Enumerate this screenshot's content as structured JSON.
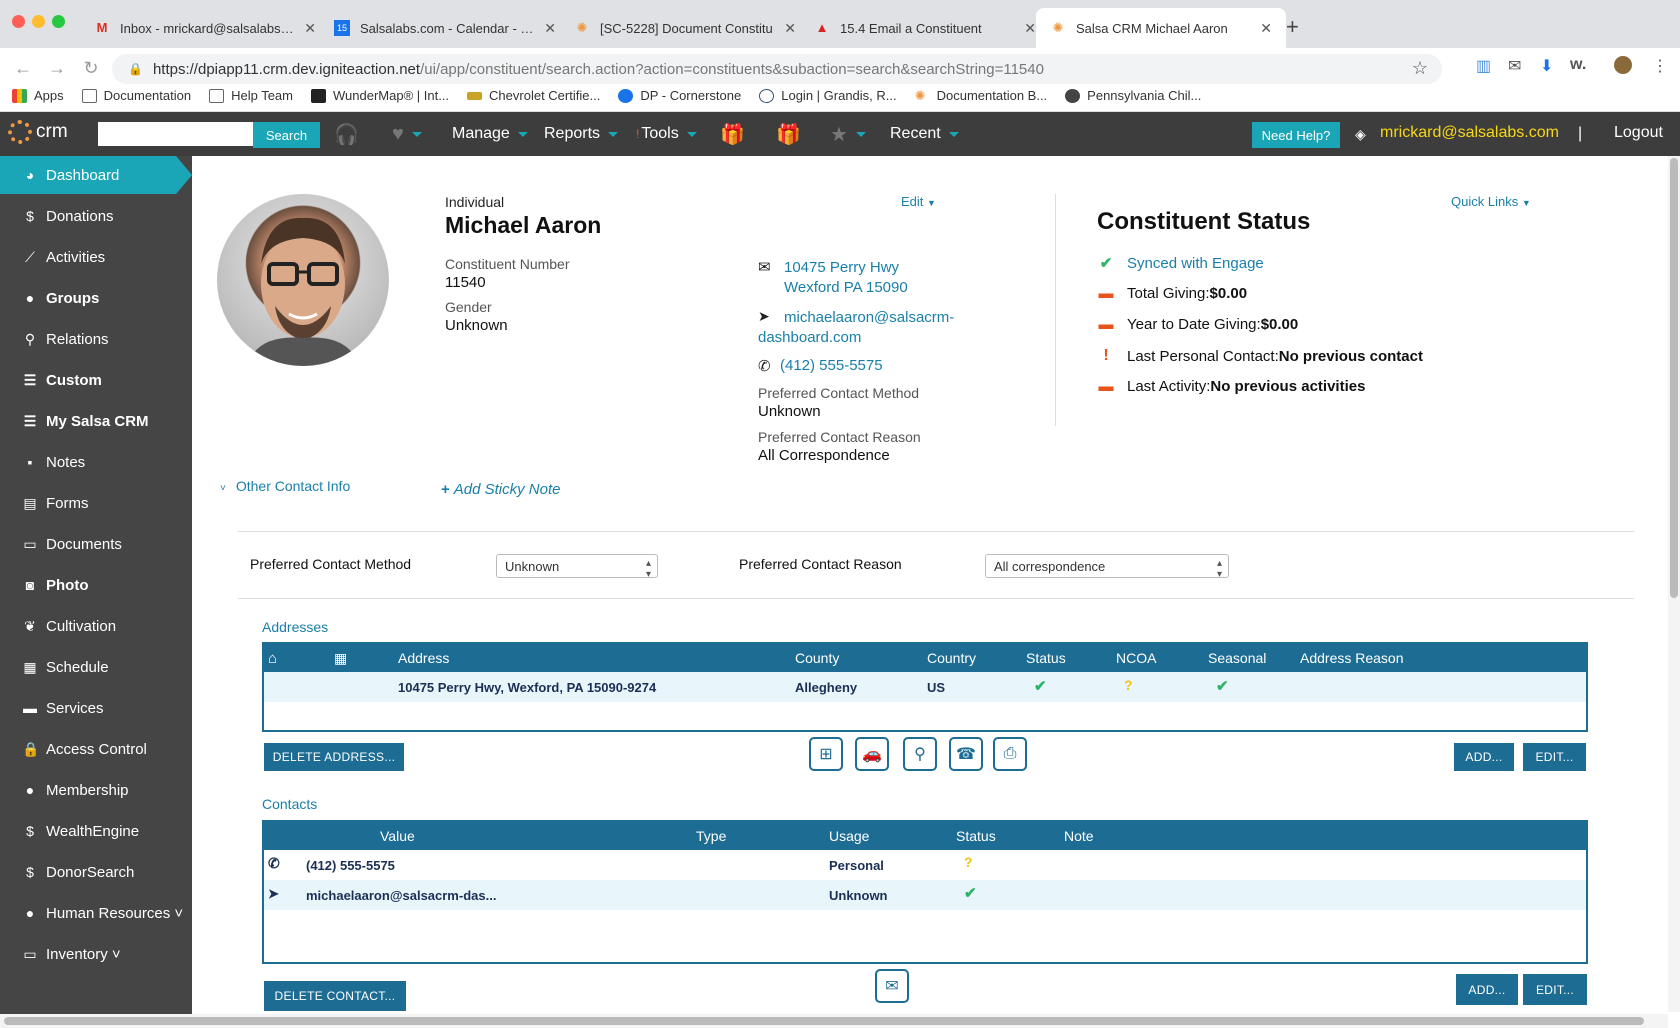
{
  "browser": {
    "tabs": [
      {
        "title": "Inbox - mrickard@salsalabs.co",
        "icon": "gmail-icon",
        "color": "#d93025"
      },
      {
        "title": "Salsalabs.com - Calendar - Mo",
        "icon": "calendar-icon",
        "color": "#1a73e8"
      },
      {
        "title": "[SC-5228] Document Constitu",
        "icon": "salsa-icon",
        "color": "#e94"
      },
      {
        "title": "15.4 Email a Constituent",
        "icon": "alert-icon",
        "color": "#d22"
      },
      {
        "title": "Salsa CRM Michael Aaron",
        "icon": "salsa-icon",
        "color": "#e94"
      }
    ],
    "url_host": "https://dpiapp11.crm.dev.igniteaction.net",
    "url_path": "/ui/app/constituent/search.action?action=constituents&subaction=search&searchString=11540",
    "bookmarks": [
      "Apps",
      "Documentation",
      "Help Team",
      "WunderMap® | Int...",
      "Chevrolet Certifie...",
      "DP - Cornerstone",
      "Login | Grandis, R...",
      "Documentation B...",
      "Pennsylvania Chil..."
    ]
  },
  "topbar": {
    "logo": "crm",
    "search_button": "Search",
    "manage": "Manage",
    "reports": "Reports",
    "tools": "Tools",
    "recent": "Recent",
    "need_help": "Need Help?",
    "user": "mrickard@salsalabs.com",
    "separator": "|",
    "logout": "Logout"
  },
  "sidebar": {
    "items": [
      {
        "label": "Dashboard",
        "icon": "dashboard-icon",
        "glyph": "◕"
      },
      {
        "label": "Donations",
        "icon": "dollar-icon",
        "glyph": "$"
      },
      {
        "label": "Activities",
        "icon": "chart-icon",
        "glyph": "⟋"
      },
      {
        "label": "Groups",
        "icon": "users-icon",
        "glyph": "●"
      },
      {
        "label": "Relations",
        "icon": "link-icon",
        "glyph": "⚲"
      },
      {
        "label": "Custom",
        "icon": "list-icon",
        "glyph": "☰"
      },
      {
        "label": "My Salsa CRM",
        "icon": "list-icon",
        "glyph": "☰"
      },
      {
        "label": "Notes",
        "icon": "note-icon",
        "glyph": "▪"
      },
      {
        "label": "Forms",
        "icon": "form-icon",
        "glyph": "▤"
      },
      {
        "label": "Documents",
        "icon": "folder-icon",
        "glyph": "▭"
      },
      {
        "label": "Photo",
        "icon": "camera-icon",
        "glyph": "◙"
      },
      {
        "label": "Cultivation",
        "icon": "leaf-icon",
        "glyph": "❦"
      },
      {
        "label": "Schedule",
        "icon": "calendar-icon",
        "glyph": "▦"
      },
      {
        "label": "Services",
        "icon": "services-icon",
        "glyph": "▬"
      },
      {
        "label": "Access Control",
        "icon": "lock-icon",
        "glyph": "🔒"
      },
      {
        "label": "Membership",
        "icon": "users-icon",
        "glyph": "●"
      },
      {
        "label": "WealthEngine",
        "icon": "dollar-icon",
        "glyph": "$"
      },
      {
        "label": "DonorSearch",
        "icon": "dollar-icon",
        "glyph": "$"
      },
      {
        "label": "Human Resources ˅",
        "icon": "user-icon",
        "glyph": "●"
      },
      {
        "label": "Inventory ˅",
        "icon": "drive-icon",
        "glyph": "▭"
      }
    ]
  },
  "profile": {
    "type": "Individual",
    "name": "Michael Aaron",
    "edit": "Edit",
    "constituent_number_label": "Constituent Number",
    "constituent_number": "11540",
    "gender_label": "Gender",
    "gender": "Unknown",
    "address_line1": "10475 Perry Hwy",
    "address_line2": "Wexford  PA  15090",
    "email_line1": "michaelaaron@salsacrm-",
    "email_line2": "dashboard.com",
    "phone": "(412) 555-5575",
    "pcm_label": "Preferred Contact Method",
    "pcm": "Unknown",
    "pcr_label": "Preferred Contact Reason",
    "pcr": "All Correspondence",
    "other_contact": "Other Contact Info",
    "sticky": "Add Sticky Note"
  },
  "status": {
    "title": "Constituent Status",
    "quick_links": "Quick Links",
    "synced": "Synced with Engage",
    "total_giving_label": "Total Giving: ",
    "total_giving": "$0.00",
    "ytd_label": "Year to Date Giving: ",
    "ytd": "$0.00",
    "last_contact_label": "Last Personal Contact: ",
    "last_contact": "No previous contact",
    "last_activity_label": "Last Activity: ",
    "last_activity": "No previous activities"
  },
  "prefs": {
    "method_label": "Preferred Contact Method",
    "method_value": "Unknown",
    "reason_label": "Preferred Contact Reason",
    "reason_value": "All correspondence"
  },
  "addresses": {
    "title": "Addresses",
    "headers": {
      "address": "Address",
      "county": "County",
      "country": "Country",
      "status": "Status",
      "ncoa": "NCOA",
      "seasonal": "Seasonal",
      "reason": "Address Reason"
    },
    "rows": [
      {
        "address": "10475 Perry Hwy, Wexford, PA 15090-9274",
        "county": "Allegheny",
        "country": "US",
        "status": "✔",
        "ncoa": "?",
        "seasonal": "✔"
      }
    ],
    "delete": "DELETE ADDRESS...",
    "add": "ADD...",
    "edit": "EDIT..."
  },
  "contacts": {
    "title": "Contacts",
    "headers": {
      "value": "Value",
      "type": "Type",
      "usage": "Usage",
      "status": "Status",
      "note": "Note"
    },
    "rows": [
      {
        "icon": "phone-icon",
        "glyph": "✆",
        "value": "(412) 555-5575",
        "usage": "Personal",
        "status": "?"
      },
      {
        "icon": "send-icon",
        "glyph": "➤",
        "value": "michaelaaron@salsacrm-das...",
        "usage": "Unknown",
        "status": "✔"
      }
    ],
    "delete": "DELETE CONTACT...",
    "add": "ADD...",
    "edit": "EDIT..."
  },
  "colors": {
    "accent": "#1aa6b7",
    "grid": "#1d6c94",
    "user": "#f7d716",
    "warn": "#e8531c"
  }
}
